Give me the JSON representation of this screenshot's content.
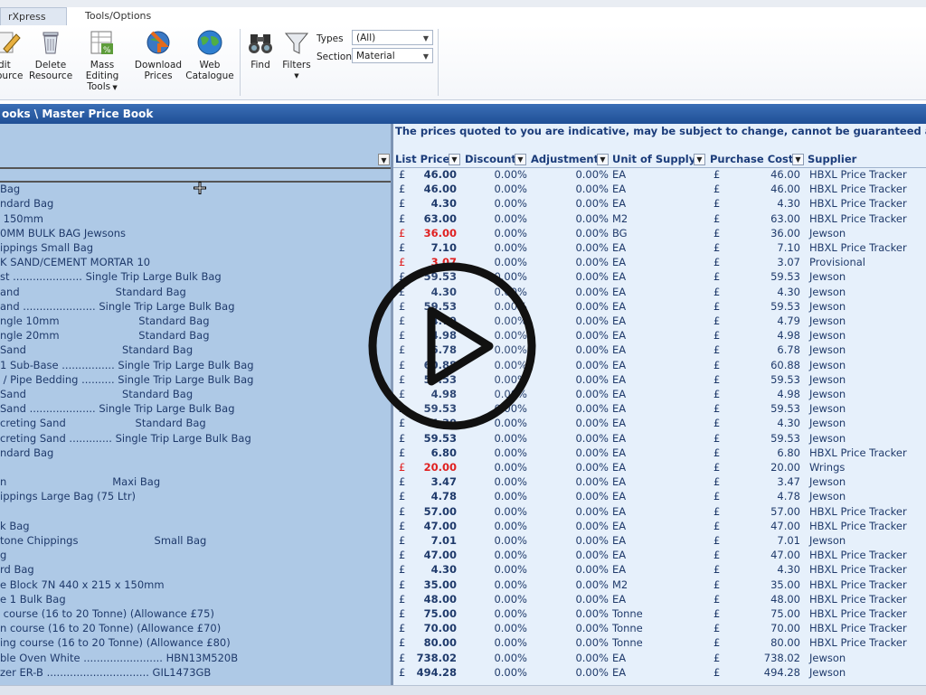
{
  "ribbon": {
    "tabs": [
      {
        "label": "rXpress Toolkit"
      },
      {
        "label": "Tools/Options"
      }
    ],
    "buttons": {
      "edit": "Edit\nResource",
      "edit_l1": "dit",
      "edit_l2": "ource",
      "delete_l1": "Delete",
      "delete_l2": "Resource",
      "mass_l1": "Mass Editing",
      "mass_l2": "Tools",
      "download_l1": "Download",
      "download_l2": "Prices",
      "web_l1": "Web",
      "web_l2": "Catalogue",
      "find": "Find",
      "filters": "Filters"
    },
    "filters": {
      "types_label": "Types",
      "types_value": "(All)",
      "section_label": "Section",
      "section_value": "Material"
    }
  },
  "title": "ooks \\ Master Price Book",
  "notice": "The prices quoted to you are indicative, may be subject to change, cannot be guaranteed and a",
  "columns": {
    "list_price": "List Price",
    "discount": "Discount",
    "adjustment": "Adjustment",
    "unit": "Unit of Supply",
    "purchase_cost": "Purchase Cost",
    "supplier": "Supplier"
  },
  "left_rows": [
    "",
    "Bag",
    "ndard Bag",
    " 150mm",
    "0MM BULK BAG Jewsons",
    "ippings Small Bag",
    "K SAND/CEMENT MORTAR 10",
    "st ..................... Single Trip Large Bulk Bag",
    "and                             Standard Bag",
    "and ...................... Single Trip Large Bulk Bag",
    "ngle 10mm                        Standard Bag",
    "ngle 20mm                        Standard Bag",
    "Sand                             Standard Bag",
    "1 Sub-Base ................ Single Trip Large Bulk Bag",
    " / Pipe Bedding .......... Single Trip Large Bulk Bag",
    "Sand                             Standard Bag",
    "Sand .................... Single Trip Large Bulk Bag",
    "creting Sand                     Standard Bag",
    "creting Sand ............. Single Trip Large Bulk Bag",
    "ndard Bag",
    "",
    "n                                Maxi Bag",
    "ippings Large Bag (75 Ltr)",
    "",
    "k Bag",
    "tone Chippings                       Small Bag",
    "g",
    "rd Bag",
    "e Block 7N 440 x 215 x 150mm",
    "e 1 Bulk Bag",
    " course (16 to 20 Tonne) (Allowance £75)",
    "n course (16 to 20 Tonne) (Allowance £70)",
    "ing course (16 to 20 Tonne) (Allowance £80)",
    "ble Oven White ........................ HBN13M520B",
    "zer ER-B ............................... GIL1473GB"
  ],
  "rows": [
    {
      "cur": "£",
      "lp": "46.00",
      "disc": "0.00%",
      "adj": "0.00%",
      "unit": "EA",
      "cur2": "£",
      "pc": "46.00",
      "sup": "HBXL Price Tracker",
      "red": false
    },
    {
      "cur": "£",
      "lp": "46.00",
      "disc": "0.00%",
      "adj": "0.00%",
      "unit": "EA",
      "cur2": "£",
      "pc": "46.00",
      "sup": "HBXL Price Tracker",
      "red": false
    },
    {
      "cur": "£",
      "lp": "4.30",
      "disc": "0.00%",
      "adj": "0.00%",
      "unit": "EA",
      "cur2": "£",
      "pc": "4.30",
      "sup": "HBXL Price Tracker",
      "red": false
    },
    {
      "cur": "£",
      "lp": "63.00",
      "disc": "0.00%",
      "adj": "0.00%",
      "unit": "M2",
      "cur2": "£",
      "pc": "63.00",
      "sup": "HBXL Price Tracker",
      "red": false
    },
    {
      "cur": "£",
      "lp": "36.00",
      "disc": "0.00%",
      "adj": "0.00%",
      "unit": "BG",
      "cur2": "£",
      "pc": "36.00",
      "sup": "Jewson",
      "red": true
    },
    {
      "cur": "£",
      "lp": "7.10",
      "disc": "0.00%",
      "adj": "0.00%",
      "unit": "EA",
      "cur2": "£",
      "pc": "7.10",
      "sup": "HBXL Price Tracker",
      "red": false
    },
    {
      "cur": "£",
      "lp": "3.07",
      "disc": "0.00%",
      "adj": "0.00%",
      "unit": "EA",
      "cur2": "£",
      "pc": "3.07",
      "sup": "Provisional",
      "red": true
    },
    {
      "cur": "£",
      "lp": "59.53",
      "disc": "0.00%",
      "adj": "0.00%",
      "unit": "EA",
      "cur2": "£",
      "pc": "59.53",
      "sup": "Jewson",
      "red": false
    },
    {
      "cur": "£",
      "lp": "4.30",
      "disc": "0.00%",
      "adj": "0.00%",
      "unit": "EA",
      "cur2": "£",
      "pc": "4.30",
      "sup": "Jewson",
      "red": false
    },
    {
      "cur": "£",
      "lp": "59.53",
      "disc": "0.00%",
      "adj": "0.00%",
      "unit": "EA",
      "cur2": "£",
      "pc": "59.53",
      "sup": "Jewson",
      "red": false
    },
    {
      "cur": "£",
      "lp": "4.79",
      "disc": "0.00%",
      "adj": "0.00%",
      "unit": "EA",
      "cur2": "£",
      "pc": "4.79",
      "sup": "Jewson",
      "red": false
    },
    {
      "cur": "£",
      "lp": "4.98",
      "disc": "0.00%",
      "adj": "0.00%",
      "unit": "EA",
      "cur2": "£",
      "pc": "4.98",
      "sup": "Jewson",
      "red": false
    },
    {
      "cur": "£",
      "lp": "6.78",
      "disc": "0.00%",
      "adj": "0.00%",
      "unit": "EA",
      "cur2": "£",
      "pc": "6.78",
      "sup": "Jewson",
      "red": false
    },
    {
      "cur": "£",
      "lp": "60.88",
      "disc": "0.00%",
      "adj": "0.00%",
      "unit": "EA",
      "cur2": "£",
      "pc": "60.88",
      "sup": "Jewson",
      "red": false
    },
    {
      "cur": "£",
      "lp": "59.53",
      "disc": "0.00%",
      "adj": "0.00%",
      "unit": "EA",
      "cur2": "£",
      "pc": "59.53",
      "sup": "Jewson",
      "red": false
    },
    {
      "cur": "£",
      "lp": "4.98",
      "disc": "0.00%",
      "adj": "0.00%",
      "unit": "EA",
      "cur2": "£",
      "pc": "4.98",
      "sup": "Jewson",
      "red": false
    },
    {
      "cur": "£",
      "lp": "59.53",
      "disc": "0.00%",
      "adj": "0.00%",
      "unit": "EA",
      "cur2": "£",
      "pc": "59.53",
      "sup": "Jewson",
      "red": false
    },
    {
      "cur": "£",
      "lp": "4.30",
      "disc": "0.00%",
      "adj": "0.00%",
      "unit": "EA",
      "cur2": "£",
      "pc": "4.30",
      "sup": "Jewson",
      "red": false
    },
    {
      "cur": "£",
      "lp": "59.53",
      "disc": "0.00%",
      "adj": "0.00%",
      "unit": "EA",
      "cur2": "£",
      "pc": "59.53",
      "sup": "Jewson",
      "red": false
    },
    {
      "cur": "£",
      "lp": "6.80",
      "disc": "0.00%",
      "adj": "0.00%",
      "unit": "EA",
      "cur2": "£",
      "pc": "6.80",
      "sup": "HBXL Price Tracker",
      "red": false
    },
    {
      "cur": "£",
      "lp": "20.00",
      "disc": "0.00%",
      "adj": "0.00%",
      "unit": "EA",
      "cur2": "£",
      "pc": "20.00",
      "sup": "Wrings",
      "red": true
    },
    {
      "cur": "£",
      "lp": "3.47",
      "disc": "0.00%",
      "adj": "0.00%",
      "unit": "EA",
      "cur2": "£",
      "pc": "3.47",
      "sup": "Jewson",
      "red": false
    },
    {
      "cur": "£",
      "lp": "4.78",
      "disc": "0.00%",
      "adj": "0.00%",
      "unit": "EA",
      "cur2": "£",
      "pc": "4.78",
      "sup": "Jewson",
      "red": false
    },
    {
      "cur": "£",
      "lp": "57.00",
      "disc": "0.00%",
      "adj": "0.00%",
      "unit": "EA",
      "cur2": "£",
      "pc": "57.00",
      "sup": "HBXL Price Tracker",
      "red": false
    },
    {
      "cur": "£",
      "lp": "47.00",
      "disc": "0.00%",
      "adj": "0.00%",
      "unit": "EA",
      "cur2": "£",
      "pc": "47.00",
      "sup": "HBXL Price Tracker",
      "red": false
    },
    {
      "cur": "£",
      "lp": "7.01",
      "disc": "0.00%",
      "adj": "0.00%",
      "unit": "EA",
      "cur2": "£",
      "pc": "7.01",
      "sup": "Jewson",
      "red": false
    },
    {
      "cur": "£",
      "lp": "47.00",
      "disc": "0.00%",
      "adj": "0.00%",
      "unit": "EA",
      "cur2": "£",
      "pc": "47.00",
      "sup": "HBXL Price Tracker",
      "red": false
    },
    {
      "cur": "£",
      "lp": "4.30",
      "disc": "0.00%",
      "adj": "0.00%",
      "unit": "EA",
      "cur2": "£",
      "pc": "4.30",
      "sup": "HBXL Price Tracker",
      "red": false
    },
    {
      "cur": "£",
      "lp": "35.00",
      "disc": "0.00%",
      "adj": "0.00%",
      "unit": "M2",
      "cur2": "£",
      "pc": "35.00",
      "sup": "HBXL Price Tracker",
      "red": false
    },
    {
      "cur": "£",
      "lp": "48.00",
      "disc": "0.00%",
      "adj": "0.00%",
      "unit": "EA",
      "cur2": "£",
      "pc": "48.00",
      "sup": "HBXL Price Tracker",
      "red": false
    },
    {
      "cur": "£",
      "lp": "75.00",
      "disc": "0.00%",
      "adj": "0.00%",
      "unit": "Tonne",
      "cur2": "£",
      "pc": "75.00",
      "sup": "HBXL Price Tracker",
      "red": false
    },
    {
      "cur": "£",
      "lp": "70.00",
      "disc": "0.00%",
      "adj": "0.00%",
      "unit": "Tonne",
      "cur2": "£",
      "pc": "70.00",
      "sup": "HBXL Price Tracker",
      "red": false
    },
    {
      "cur": "£",
      "lp": "80.00",
      "disc": "0.00%",
      "adj": "0.00%",
      "unit": "Tonne",
      "cur2": "£",
      "pc": "80.00",
      "sup": "HBXL Price Tracker",
      "red": false
    },
    {
      "cur": "£",
      "lp": "738.02",
      "disc": "0.00%",
      "adj": "0.00%",
      "unit": "EA",
      "cur2": "£",
      "pc": "738.02",
      "sup": "Jewson",
      "red": false
    },
    {
      "cur": "£",
      "lp": "494.28",
      "disc": "0.00%",
      "adj": "0.00%",
      "unit": "EA",
      "cur2": "£",
      "pc": "494.28",
      "sup": "Jewson",
      "red": false
    }
  ],
  "colors": {
    "title_bar": "#2a5ca6",
    "left_pane": "#aec9e6",
    "right_pane": "#e6f0fb",
    "warning_red": "#e02020"
  },
  "icons": [
    "edit-icon",
    "delete-bin-icon",
    "mass-editing-icon",
    "download-prices-icon",
    "web-catalogue-globe-icon",
    "binoculars-icon",
    "funnel-filter-icon",
    "play-icon",
    "move-cursor-icon"
  ]
}
